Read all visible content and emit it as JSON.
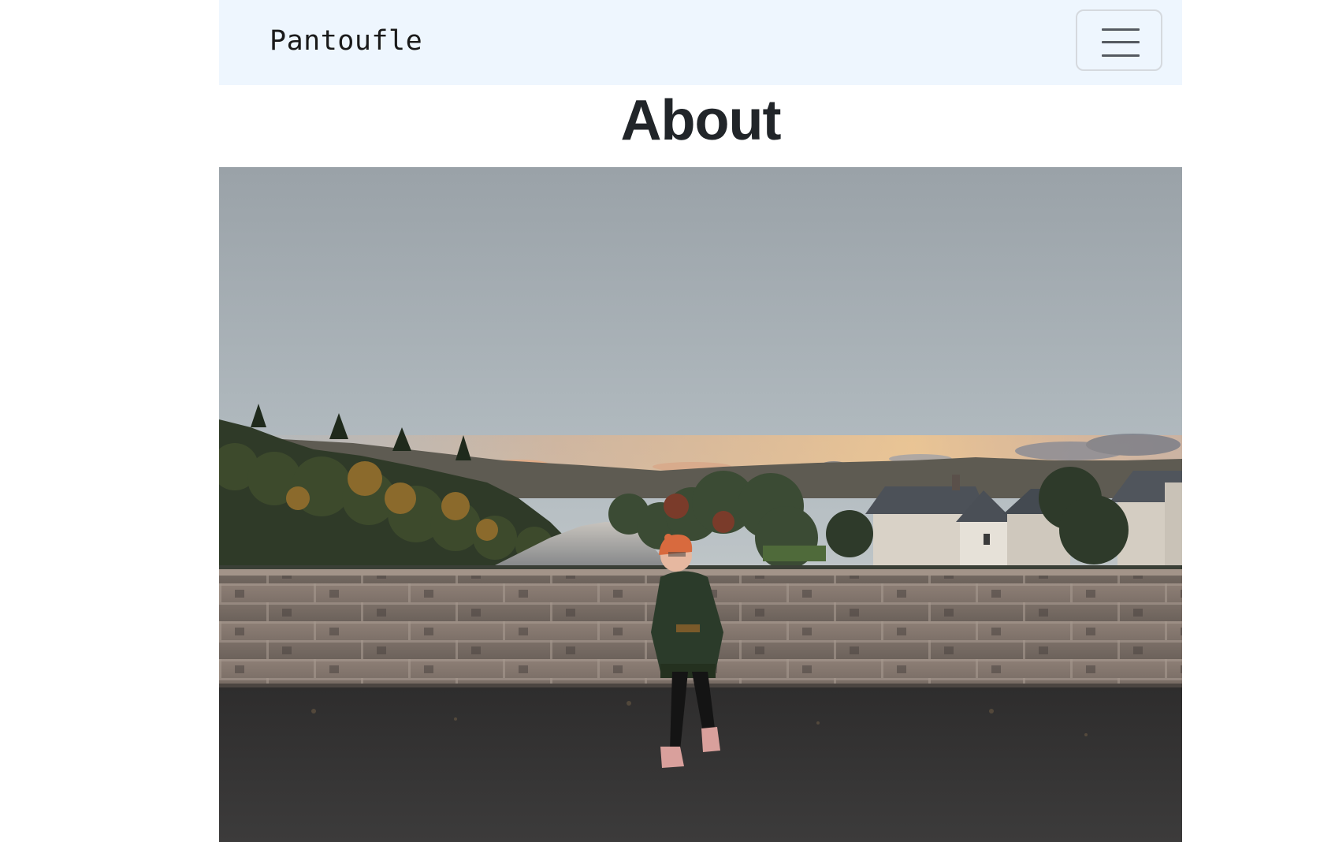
{
  "navbar": {
    "brand": "Pantoufle",
    "toggler_icon": "hamburger-menu-icon",
    "background": "#eef6fe"
  },
  "main": {
    "title": "About",
    "hero_image": {
      "description_icon": "photo-person-on-stone-bridge-at-sunset"
    }
  }
}
